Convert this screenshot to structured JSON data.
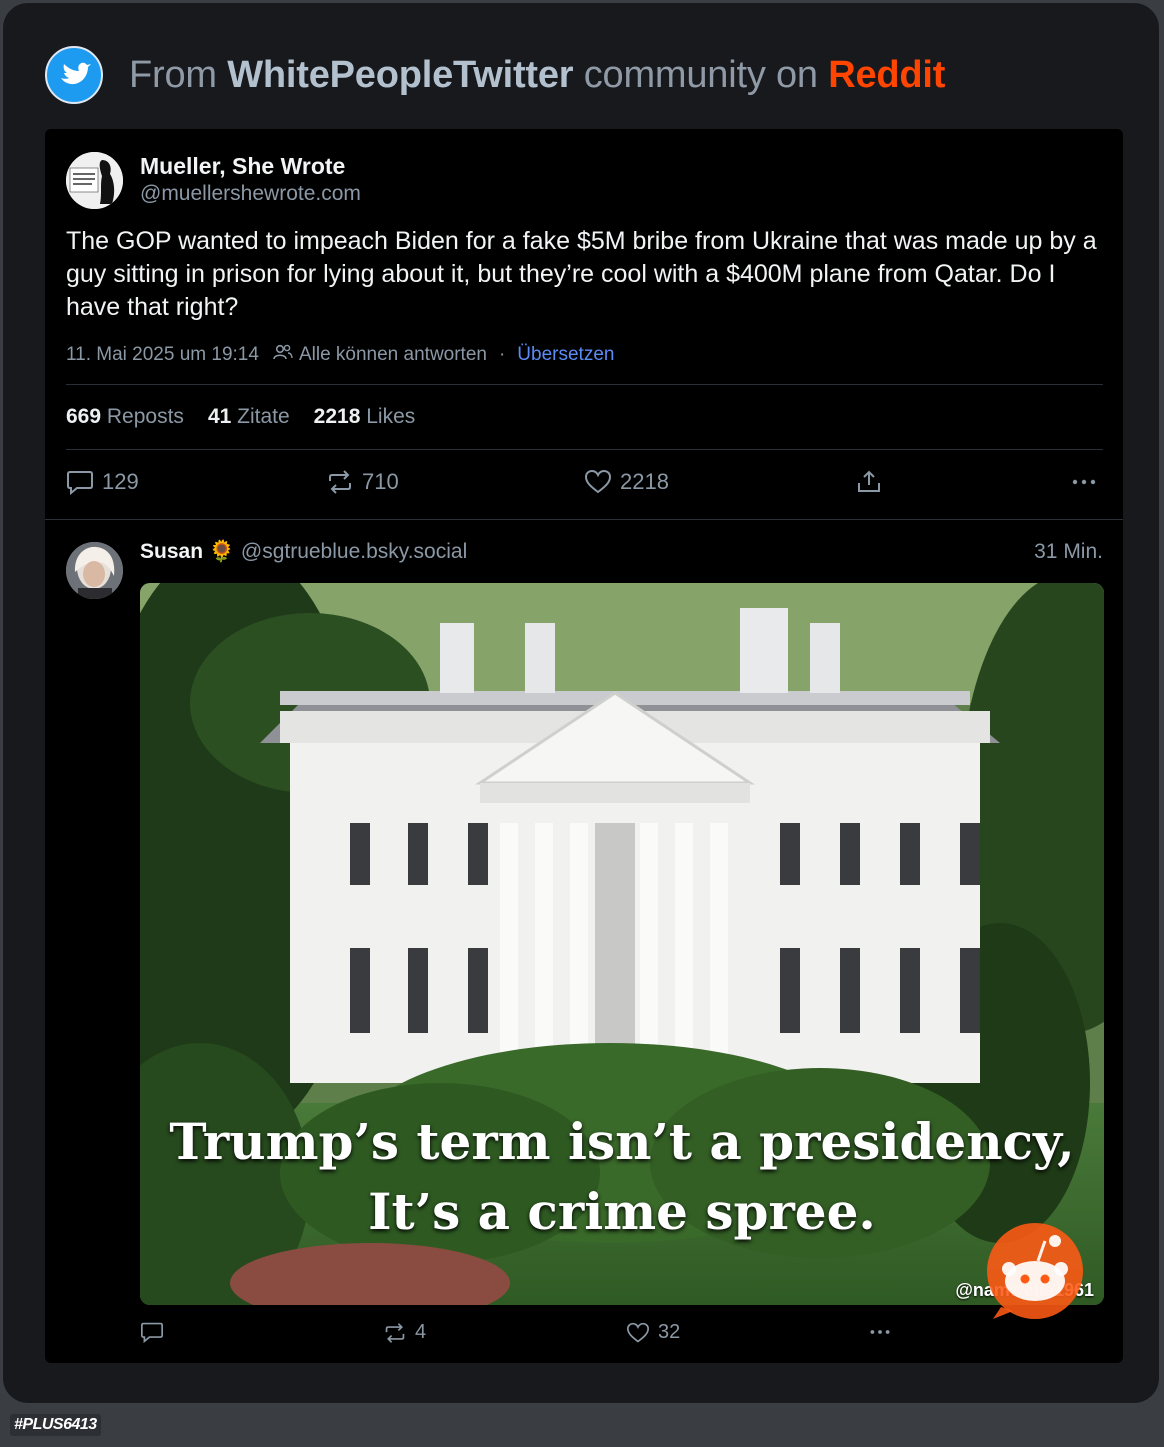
{
  "header": {
    "prefix": "From ",
    "community": "WhitePeopleTwitter",
    "middle": " community on ",
    "platform": "Reddit",
    "icon": "twitter-bird-icon",
    "platform_color": "#ff4500"
  },
  "post": {
    "author": "Mueller, She Wrote",
    "handle": "@muellershewrote.com",
    "body": "The GOP wanted to impeach Biden for a fake $5M bribe from Ukraine that was made up by a guy sitting in prison for lying about it, but they’re cool with a $400M plane from Qatar. Do I have that right?",
    "date": "11. Mai 2025 um 19:14",
    "reply_setting": "Alle können antworten",
    "separator": "·",
    "translate": "Übersetzen",
    "stats": {
      "reposts_count": "669",
      "reposts_label": "Reposts",
      "quotes_count": "41",
      "quotes_label": "Zitate",
      "likes_count": "2218",
      "likes_label": "Likes"
    },
    "actions": {
      "replies": "129",
      "reposts": "710",
      "likes": "2218"
    }
  },
  "reply": {
    "author": "Susan",
    "emoji": "🌻",
    "handle": "@sgtrueblue.bsky.social",
    "time": "31 Min.",
    "image": {
      "caption_line1": "Trump’s term isn’t a presidency,",
      "caption_line2": "It’s a crime spree.",
      "watermark": "@namwella1961"
    },
    "actions": {
      "reposts": "4",
      "likes": "32"
    }
  },
  "footer": {
    "logo_text": "#PLUS6413"
  }
}
